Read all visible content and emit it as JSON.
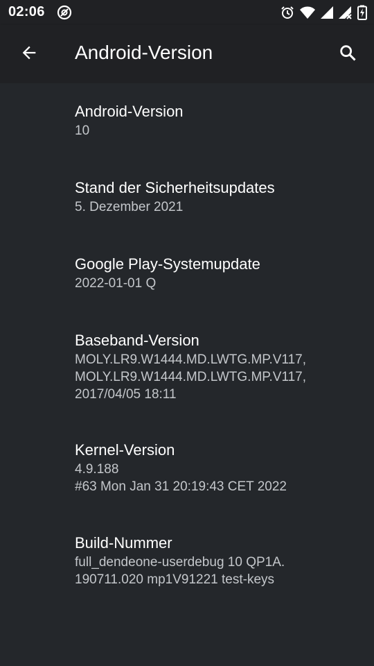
{
  "status_bar": {
    "time": "02:06",
    "left_icon": "at-sign-icon",
    "right_icons": [
      "alarm-icon",
      "wifi-icon",
      "signal-icon",
      "signal-x-icon",
      "battery-charging-icon"
    ]
  },
  "app_bar": {
    "title": "Android-Version",
    "back_icon": "arrow-back-icon",
    "search_icon": "search-icon"
  },
  "items": [
    {
      "title": "Android-Version",
      "summary": "10"
    },
    {
      "title": "Stand der Sicherheitsupdates",
      "summary": "5. Dezember 2021"
    },
    {
      "title": "Google Play-Systemupdate",
      "summary": "2022-01-01 Q"
    },
    {
      "title": "Baseband-Version",
      "summary": "MOLY.LR9.W1444.MD.LWTG.MP.V117,\nMOLY.LR9.W1444.MD.LWTG.MP.V117,\n2017/04/05 18:11"
    },
    {
      "title": "Kernel-Version",
      "summary": "4.9.188\n#63 Mon Jan 31 20:19:43 CET 2022"
    },
    {
      "title": "Build-Nummer",
      "summary": "full_dendeone-userdebug 10 QP1A.\n190711.020 mp1V91221 test-keys"
    }
  ],
  "colors": {
    "background": "#24272b",
    "appbar": "#202124",
    "title_text": "#ffffff",
    "summary_text": "#c4c7cb"
  }
}
